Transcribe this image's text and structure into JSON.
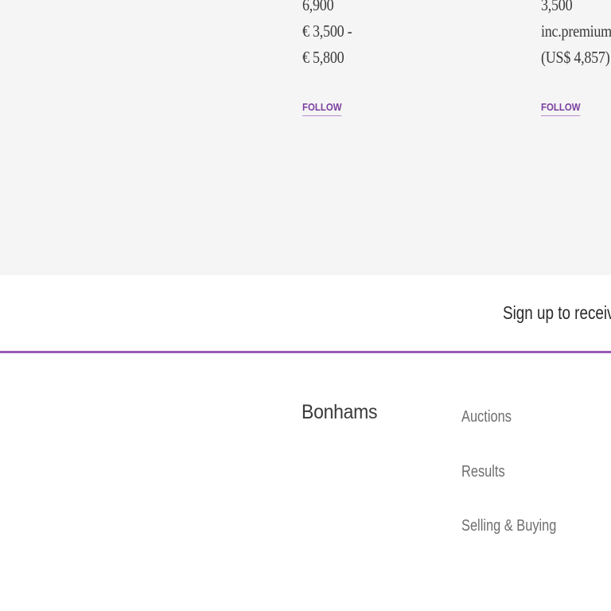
{
  "lots": [
    {
      "price_lines": [
        "6,900",
        "€ 3,500 -",
        "€ 5,800"
      ],
      "follow_label": "FOLLOW"
    },
    {
      "price_lines": [
        "3,500",
        "inc.premium",
        "(US$ 4,857)"
      ],
      "follow_label": "FOLLOW"
    }
  ],
  "signup": {
    "text": "Sign up to receive"
  },
  "footer": {
    "logo": "Bonhams",
    "links": [
      "Auctions",
      "Results",
      "Selling & Buying"
    ]
  },
  "colors": {
    "accent": "#7b3f9e",
    "divider": "#9a59b5",
    "section_bg": "#f5f5f5"
  }
}
